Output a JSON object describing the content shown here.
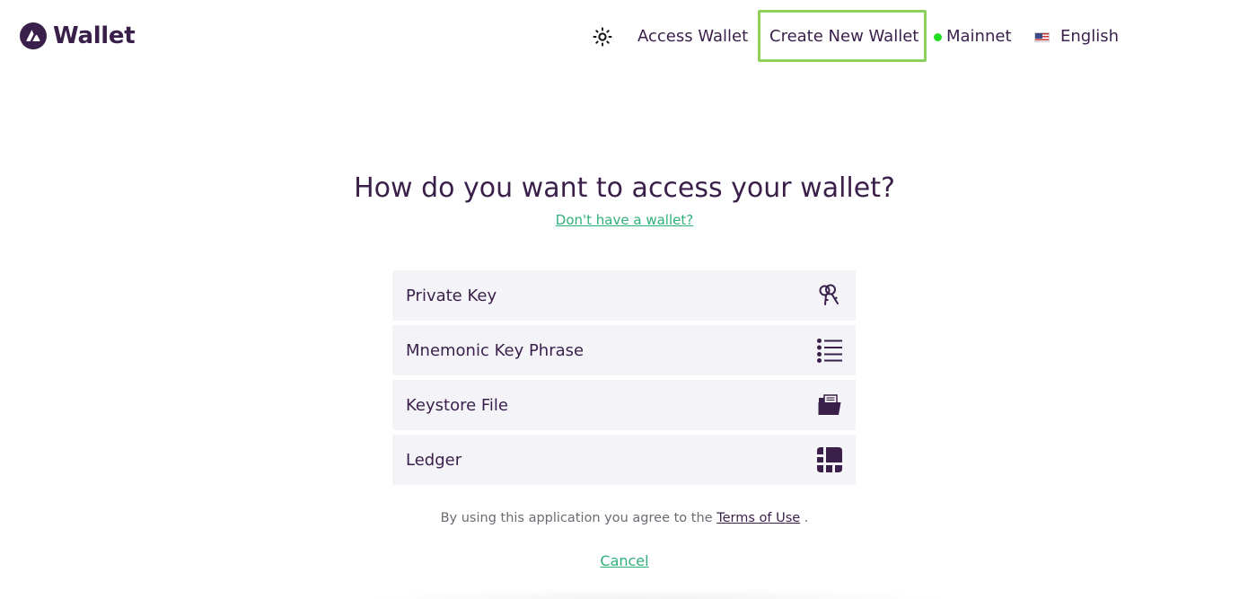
{
  "header": {
    "logo_text": "Wallet",
    "logo_icon": "avalanche-logo-icon",
    "theme_icon": "sun-icon",
    "nav": {
      "access_wallet": "Access Wallet",
      "create_new_wallet": "Create New Wallet",
      "network": "Mainnet",
      "language": "English"
    }
  },
  "main": {
    "title": "How do you want to access your wallet?",
    "no_wallet_link": "Don't have a wallet?",
    "options": [
      {
        "label": "Private Key",
        "icon": "keys-icon"
      },
      {
        "label": "Mnemonic Key Phrase",
        "icon": "list-icon"
      },
      {
        "label": "Keystore File",
        "icon": "folder-icon"
      },
      {
        "label": "Ledger",
        "icon": "ledger-icon"
      }
    ],
    "terms_prefix": "By using this application you agree to the",
    "terms_link": "Terms of Use",
    "terms_suffix": ".",
    "cancel": "Cancel"
  },
  "colors": {
    "primary_text": "#3a1f4a",
    "accent_green": "#2fb07a",
    "status_green": "#22dd22",
    "highlight_box": "#8fcf5c",
    "option_bg": "#f4f4f8"
  }
}
